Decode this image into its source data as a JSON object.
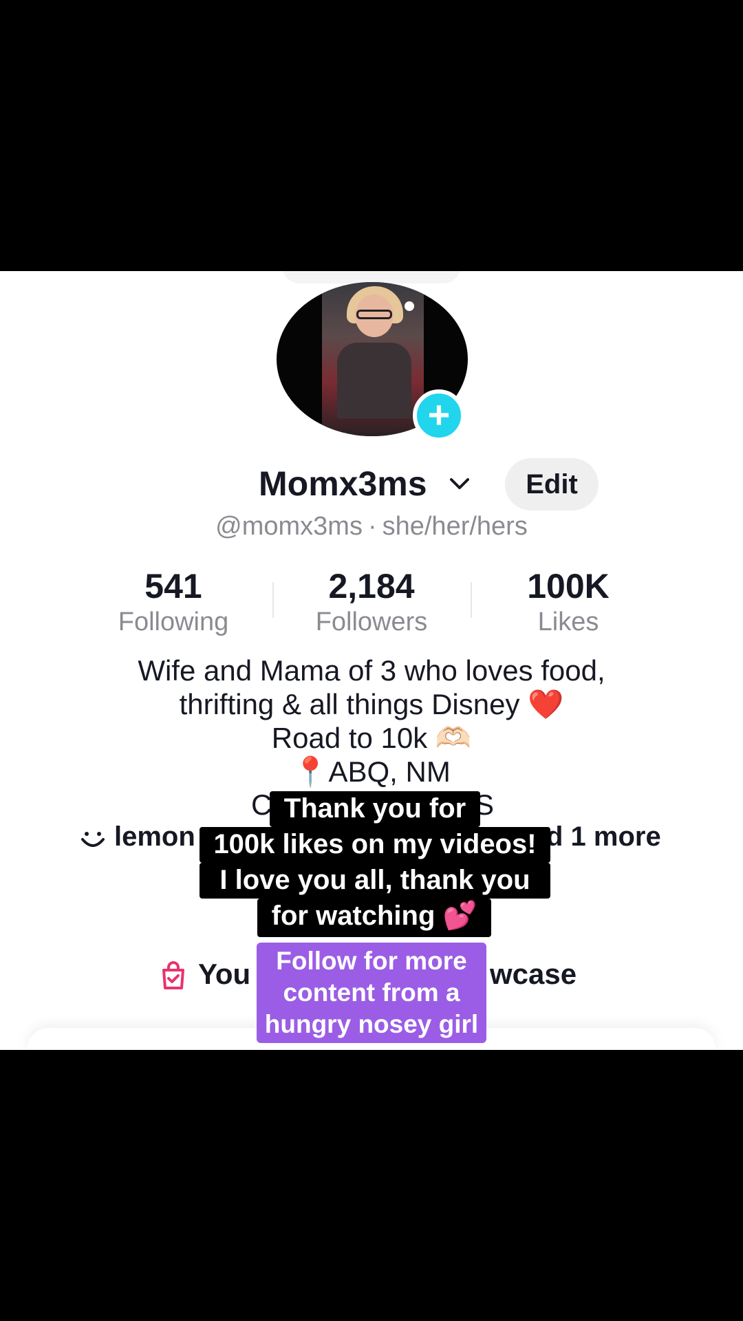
{
  "profile": {
    "display_name": "Momx3ms",
    "edit_label": "Edit",
    "username": "@momx3ms",
    "pronouns": "she/her/hers",
    "separator": "·"
  },
  "stats": [
    {
      "value": "541",
      "label": "Following"
    },
    {
      "value": "2,184",
      "label": "Followers"
    },
    {
      "value": "100K",
      "label": "Likes"
    }
  ],
  "bio": {
    "line1": "Wife and Mama of 3 who loves food,",
    "line2": "thrifting & all things Disney ❤️",
    "line3": "Road to 10k 🫶🏻",
    "line4": "📍ABQ, NM",
    "line5_visible_start": "C",
    "line5_visible_end": "S"
  },
  "link": {
    "icon": "smile-icon",
    "visible_start": "lemon",
    "visible_end": "d 1 more"
  },
  "showcase": {
    "icon": "shopping-bag-icon",
    "visible_start": "You",
    "visible_end": "wcase"
  },
  "captions": {
    "line1": "Thank you for",
    "line2": "100k likes on my videos!",
    "line3": "I love you all, thank you",
    "line4": "for watching 💕",
    "purple_line1": "Follow for more",
    "purple_line2": "content from a",
    "purple_line3": "hungry nosey girl"
  },
  "colors": {
    "accent_cyan": "#20d5ec",
    "caption_purple": "#9b5de5",
    "text_primary": "#161823",
    "text_secondary": "#8a8b91",
    "bag_pink": "#e8336d"
  }
}
